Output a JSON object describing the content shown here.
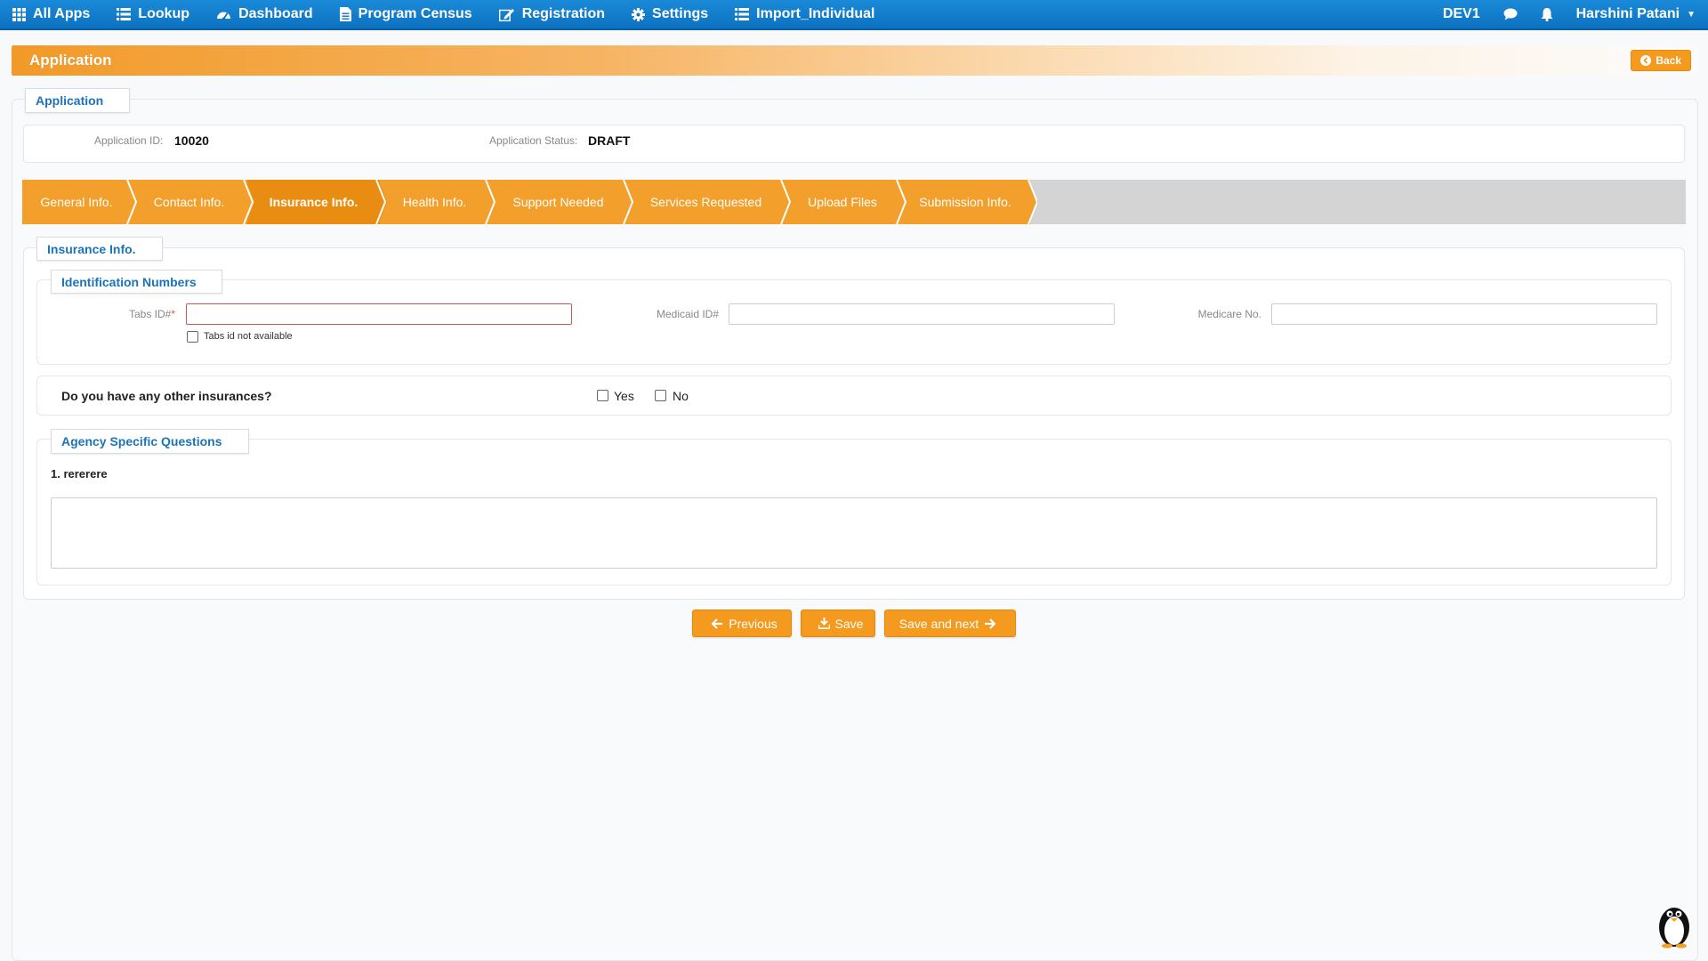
{
  "nav": {
    "items": [
      {
        "label": "All Apps",
        "icon": "grid-icon"
      },
      {
        "label": "Lookup",
        "icon": "list-icon"
      },
      {
        "label": "Dashboard",
        "icon": "dashboard-icon"
      },
      {
        "label": "Program Census",
        "icon": "file-icon"
      },
      {
        "label": "Registration",
        "icon": "edit-icon"
      },
      {
        "label": "Settings",
        "icon": "gear-icon"
      },
      {
        "label": "Import_Individual",
        "icon": "list-icon"
      }
    ],
    "environment": "DEV1",
    "user_name": "Harshini Patani"
  },
  "header": {
    "title": "Application",
    "back_label": "Back"
  },
  "application": {
    "section_label": "Application",
    "id_label": "Application ID:",
    "id_value": "10020",
    "status_label": "Application Status:",
    "status_value": "DRAFT"
  },
  "steps": [
    {
      "label": "General Info.",
      "active": false
    },
    {
      "label": "Contact Info.",
      "active": false
    },
    {
      "label": "Insurance Info.",
      "active": true
    },
    {
      "label": "Health Info.",
      "active": false
    },
    {
      "label": "Support Needed",
      "active": false
    },
    {
      "label": "Services Requested",
      "active": false
    },
    {
      "label": "Upload Files",
      "active": false
    },
    {
      "label": "Submission Info.",
      "active": false
    }
  ],
  "insurance": {
    "section_label": "Insurance Info.",
    "identification": {
      "legend": "Identification Numbers",
      "tabs_id_label": "Tabs ID#",
      "tabs_id_required": "*",
      "tabs_id_value": "",
      "tabs_not_available_label": "Tabs id not available",
      "medicaid_label": "Medicaid ID#",
      "medicaid_value": "",
      "medicare_label": "Medicare No.",
      "medicare_value": ""
    },
    "other_insurance": {
      "question": "Do you have any other insurances?",
      "yes_label": "Yes",
      "no_label": "No"
    },
    "agency": {
      "legend": "Agency Specific Questions",
      "question_1": "1. rererere",
      "answer_1": ""
    }
  },
  "buttons": {
    "previous": "Previous",
    "save": "Save",
    "save_next": "Save and next"
  },
  "colors": {
    "nav_blue": "#0d72c0",
    "accent_orange": "#f39a1f",
    "active_step": "#e98c12",
    "link_blue": "#1d73b8",
    "error_red": "#d9534f"
  }
}
